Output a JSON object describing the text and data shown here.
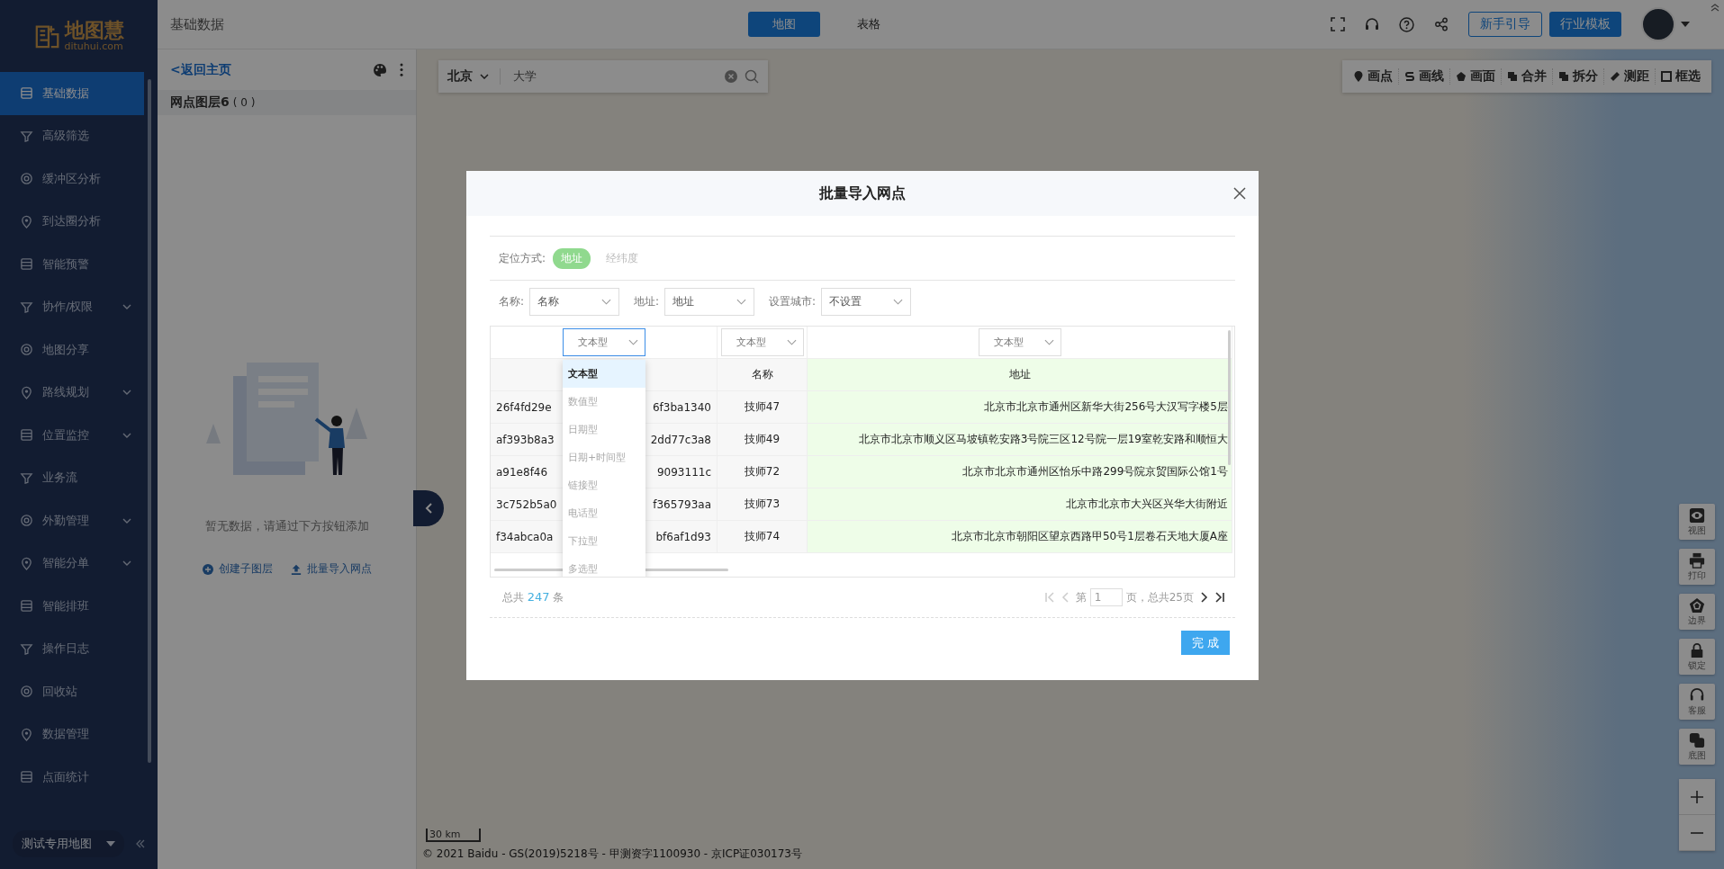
{
  "sidebar": {
    "logo": {
      "name": "地图慧",
      "domain": "dituhui.com"
    },
    "items": [
      {
        "label": "基础数据",
        "selected": true,
        "kind": "item"
      },
      {
        "label": "高级筛选",
        "selected": false,
        "kind": "item"
      },
      {
        "label": "缓冲区分析",
        "selected": false,
        "kind": "item"
      },
      {
        "label": "到达圈分析",
        "selected": false,
        "kind": "item"
      },
      {
        "label": "智能预警",
        "selected": false,
        "kind": "item"
      },
      {
        "label": "协作/权限",
        "selected": false,
        "kind": "submenu"
      },
      {
        "label": "地图分享",
        "selected": false,
        "kind": "item"
      },
      {
        "label": "路线规划",
        "selected": false,
        "kind": "submenu"
      },
      {
        "label": "位置监控",
        "selected": false,
        "kind": "submenu"
      },
      {
        "label": "业务流",
        "selected": false,
        "kind": "item"
      },
      {
        "label": "外勤管理",
        "selected": false,
        "kind": "submenu"
      },
      {
        "label": "智能分单",
        "selected": false,
        "kind": "submenu"
      },
      {
        "label": "智能排班",
        "selected": false,
        "kind": "item"
      },
      {
        "label": "操作日志",
        "selected": false,
        "kind": "item"
      },
      {
        "label": "回收站",
        "selected": false,
        "kind": "item"
      },
      {
        "label": "数据管理",
        "selected": false,
        "kind": "item"
      },
      {
        "label": "点面统计",
        "selected": false,
        "kind": "item"
      }
    ],
    "map_selector": "测试专用地图"
  },
  "top_bar": {
    "title": "基础数据",
    "view_tabs": [
      {
        "label": "地图",
        "selected": true
      },
      {
        "label": "表格",
        "selected": false
      }
    ],
    "buttons": [
      {
        "label": "新手引导",
        "kind": "outline"
      },
      {
        "label": "行业模板",
        "kind": "primary"
      }
    ]
  },
  "layer_panel": {
    "back_link": "<返回主页",
    "layer": {
      "name": "网点图层6",
      "count": "( 0 )"
    },
    "empty_text": "暂无数据，请通过下方按钮添加",
    "actions": [
      "创建子图层",
      "批量导入网点"
    ]
  },
  "map": {
    "search": {
      "city": "北京",
      "value": "大学"
    },
    "tools": [
      "画点",
      "画线",
      "画面",
      "合并",
      "拆分",
      "测距",
      "框选"
    ],
    "side_tools": [
      "视图",
      "打印",
      "边界",
      "锁定",
      "客服",
      "底图"
    ],
    "scale": "30 km",
    "copyright": "© 2021 Baidu - GS(2019)5218号 - 甲测资字1100930 - 京ICP证030173号"
  },
  "dialog": {
    "title": "批量导入网点",
    "locate": {
      "label": "定位方式:",
      "options": [
        {
          "label": "地址",
          "selected": true
        },
        {
          "label": "经纬度",
          "selected": false
        }
      ]
    },
    "mappings": [
      {
        "label": "名称:",
        "value": "名称"
      },
      {
        "label": "地址:",
        "value": "地址"
      },
      {
        "label": "设置城市:",
        "value": "不设置"
      }
    ],
    "table": {
      "type_selects": [
        {
          "value": "文本型",
          "open": true
        },
        {
          "value": "文本型",
          "open": false
        },
        {
          "value": "文本型",
          "open": false
        }
      ],
      "headers": [
        "名称",
        "地址"
      ],
      "rows": [
        {
          "id_start": "26f4fd29e",
          "id_end": "6f3ba1340",
          "name": "技师47",
          "address": "北京市北京市通州区新华大街256号大汉写字楼5层"
        },
        {
          "id_start": "af393b8a3",
          "id_end": "2dd77c3a8",
          "name": "技师49",
          "address": "北京市北京市顺义区马坡镇乾安路3号院三区12号院一层19室乾安路和顺恒大"
        },
        {
          "id_start": "a91e8f46",
          "id_end": "9093111c",
          "name": "技师72",
          "address": "北京市北京市通州区怡乐中路299号院京贸国际公馆1号"
        },
        {
          "id_start": "3c752b5a0",
          "id_end": "f365793aa",
          "name": "技师73",
          "address": "北京市北京市大兴区兴华大街附近"
        },
        {
          "id_start": "f34abca0a",
          "id_end": "bf6af1d93",
          "name": "技师74",
          "address": "北京市北京市朝阳区望京西路甲50号1层卷石天地大厦A座"
        }
      ],
      "type_options": [
        {
          "label": "文本型",
          "selected": true
        },
        {
          "label": "数值型",
          "selected": false
        },
        {
          "label": "日期型",
          "selected": false
        },
        {
          "label": "日期+时间型",
          "selected": false
        },
        {
          "label": "链接型",
          "selected": false
        },
        {
          "label": "电话型",
          "selected": false
        },
        {
          "label": "下拉型",
          "selected": false
        },
        {
          "label": "多选型",
          "selected": false
        }
      ]
    },
    "total": {
      "prefix": "总共",
      "count": "247",
      "suffix": "条"
    },
    "pagination": {
      "before": "第",
      "page": "1",
      "after": "页，总共25页"
    },
    "confirm": "完 成"
  }
}
